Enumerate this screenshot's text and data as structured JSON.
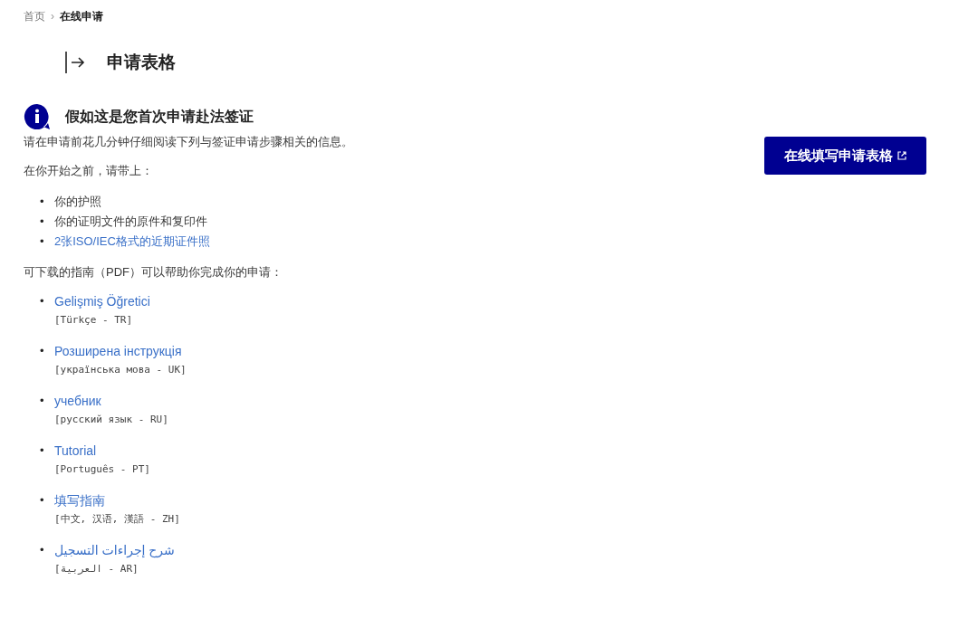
{
  "breadcrumb": {
    "items": [
      "首页",
      "在线申请"
    ],
    "separator": "›"
  },
  "heading": {
    "title": "申请表格"
  },
  "notice": {
    "title": "假如这是您首次申请赴法签证",
    "intro": "请在申请前花几分钟仔细阅读下列与签证申请步骤相关的信息。",
    "bring_label": "在你开始之前，请带上：",
    "bullet": "•",
    "bring_items": [
      {
        "kind": "text",
        "text": "你的护照"
      },
      {
        "kind": "text",
        "text": "你的证明文件的原件和复印件"
      },
      {
        "kind": "link",
        "text": "2张ISO/IEC格式的近期证件照"
      }
    ],
    "guides_label": "可下载的指南（PDF）可以帮助你完成你的申请：",
    "guides": [
      {
        "title": "Gelişmiş Öğretici",
        "language": "[Türkçe - TR]"
      },
      {
        "title": "Розширена інструкція",
        "language": "[українська мова - UK]"
      },
      {
        "title": "учебник",
        "language": "[русский язык - RU]"
      },
      {
        "title": "Tutorial",
        "language": "[Português - PT]"
      },
      {
        "title": "填写指南",
        "language": "[中文, 汉语, 漢語 - ZH]"
      },
      {
        "title": "شرح إجراءات التسجيل",
        "language": "[العربية - AR]"
      }
    ]
  },
  "apply_button": {
    "label": "在线填写申请表格"
  }
}
